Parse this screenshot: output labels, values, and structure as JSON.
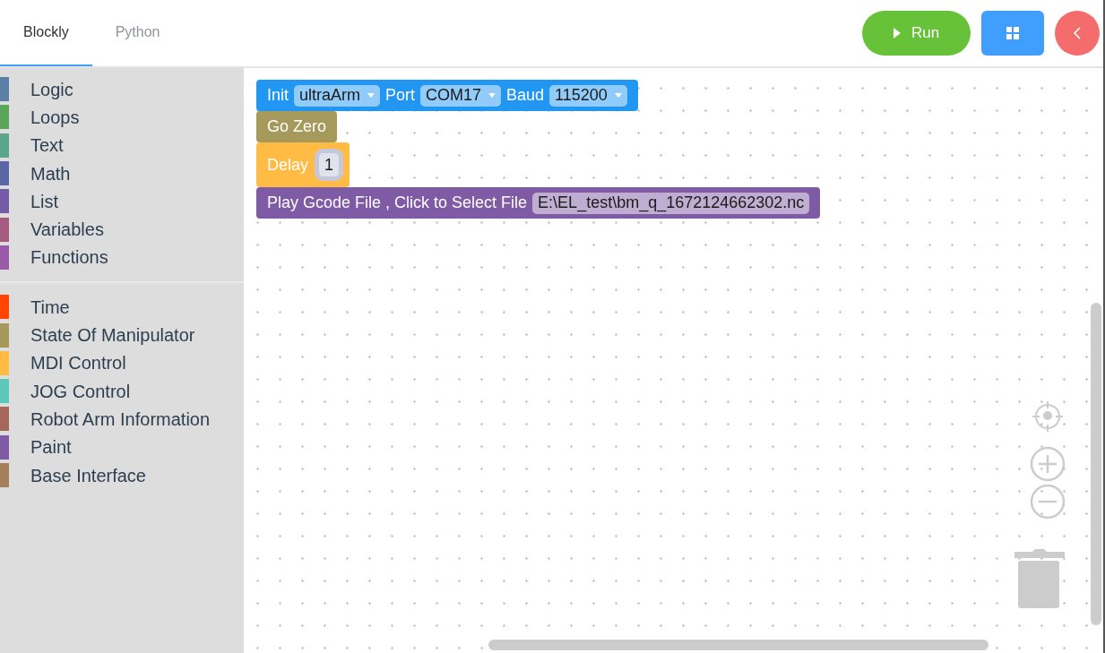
{
  "tabs": [
    {
      "label": "Blockly",
      "selected": true
    },
    {
      "label": "Python",
      "selected": false
    }
  ],
  "toolbar": {
    "run_label": "Run"
  },
  "categories": [
    [
      {
        "label": "Logic",
        "color": "#5b80a5"
      },
      {
        "label": "Loops",
        "color": "#5ba55b"
      },
      {
        "label": "Text",
        "color": "#5ba58c"
      },
      {
        "label": "Math",
        "color": "#5b67a5"
      },
      {
        "label": "List",
        "color": "#745ba5"
      },
      {
        "label": "Variables",
        "color": "#a55b80"
      },
      {
        "label": "Functions",
        "color": "#995ba5"
      }
    ],
    [
      {
        "label": "Time",
        "color": "#ff4500"
      },
      {
        "label": "State Of Manipulator",
        "color": "#a59a5b"
      },
      {
        "label": "MDI Control",
        "color": "#ffbb44"
      },
      {
        "label": "JOG Control",
        "color": "#5cc8bb"
      },
      {
        "label": "Robot Arm Information",
        "color": "#a5675b"
      },
      {
        "label": "Paint",
        "color": "#7f5ba5"
      },
      {
        "label": "Base Interface",
        "color": "#a57f5b"
      }
    ]
  ],
  "blocks": [
    {
      "color": "#2196f3",
      "parts": [
        {
          "kind": "text",
          "text": "Init"
        },
        {
          "kind": "dropdown",
          "text": "ultraArm"
        },
        {
          "kind": "text",
          "text": "Port"
        },
        {
          "kind": "dropdown",
          "text": "COM17"
        },
        {
          "kind": "text",
          "text": "Baud"
        },
        {
          "kind": "dropdown",
          "text": "115200"
        }
      ]
    },
    {
      "color": "#a59a5b",
      "parts": [
        {
          "kind": "text",
          "text": "Go Zero"
        }
      ]
    },
    {
      "color": "#ffbb44",
      "parts": [
        {
          "kind": "text",
          "text": "Delay"
        },
        {
          "kind": "value",
          "text": "1"
        }
      ]
    },
    {
      "color": "#7f5ba5",
      "parts": [
        {
          "kind": "text",
          "text": "Play Gcode File , Click to Select File"
        },
        {
          "kind": "field",
          "text": "E:\\EL_test\\bm_q_1672124662302.nc"
        }
      ]
    }
  ]
}
